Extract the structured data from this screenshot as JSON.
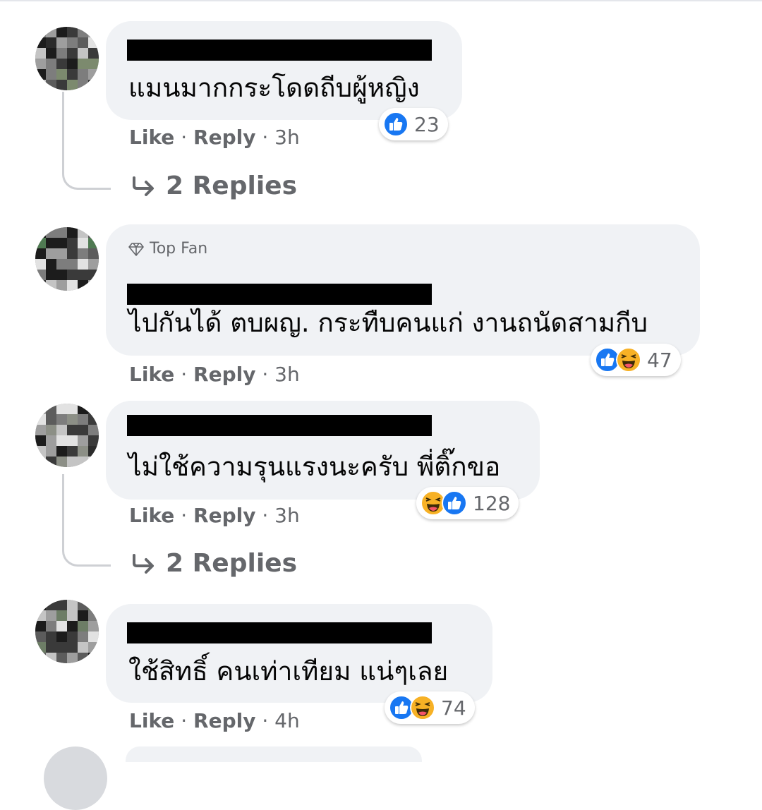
{
  "comments": [
    {
      "text": "แมนมากกระโดดถีบผู้หญิง",
      "reactions": {
        "count": "23",
        "icons": [
          "like-icon"
        ]
      },
      "actions": {
        "like": "Like",
        "reply": "Reply",
        "time": "3h"
      },
      "replies_label": "2 Replies"
    },
    {
      "badge": "Top Fan",
      "text": "ไปกันได้ ตบผญ. กระทืบคนแก่ งานถนัดสามกีบ",
      "reactions": {
        "count": "47",
        "icons": [
          "like-icon",
          "haha-icon"
        ]
      },
      "actions": {
        "like": "Like",
        "reply": "Reply",
        "time": "3h"
      }
    },
    {
      "text": "ไม่ใช้ความรุนแรงนะครับ พี่ติ๊กขอ",
      "reactions": {
        "count": "128",
        "icons": [
          "haha-icon",
          "like-icon"
        ]
      },
      "actions": {
        "like": "Like",
        "reply": "Reply",
        "time": "3h"
      },
      "replies_label": "2 Replies"
    },
    {
      "text": "ใช้สิทธิ์ คนเท่าเทียม แน่ๆเลย",
      "reactions": {
        "count": "74",
        "icons": [
          "like-icon",
          "haha-icon"
        ]
      },
      "actions": {
        "like": "Like",
        "reply": "Reply",
        "time": "4h"
      }
    }
  ],
  "colors": {
    "bubble": "#f0f2f5",
    "meta_text": "#65676b",
    "like_blue": "#1877f2",
    "haha_yellow": "#f7b125"
  }
}
